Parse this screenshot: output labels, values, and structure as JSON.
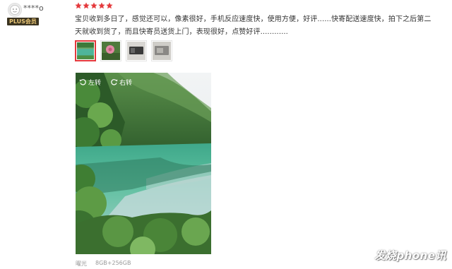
{
  "user": {
    "avatar_icon": "default-avatar-icon",
    "name": "****o",
    "badge": "PLUS会员"
  },
  "review": {
    "rating": 5,
    "rating_max": 5,
    "star_color": "#e4393c",
    "text": "宝贝收到多日了，感觉还可以，像素很好，手机反应速度快，使用方便，好评......快寄配送速度快，拍下之后第二天就收到货了，而且快寄员送货上门，表现很好，点赞好评............"
  },
  "photos": {
    "thumbnails": [
      {
        "name": "lake",
        "active": true
      },
      {
        "name": "pink-flower",
        "active": false
      },
      {
        "name": "dark-device",
        "active": false
      },
      {
        "name": "device-box",
        "active": false
      }
    ],
    "rotate_left_label": "左转",
    "rotate_right_label": "右转"
  },
  "purchase": {
    "color": "曜光",
    "spec": "8GB+256GB"
  },
  "watermark": "发烧phone讯"
}
